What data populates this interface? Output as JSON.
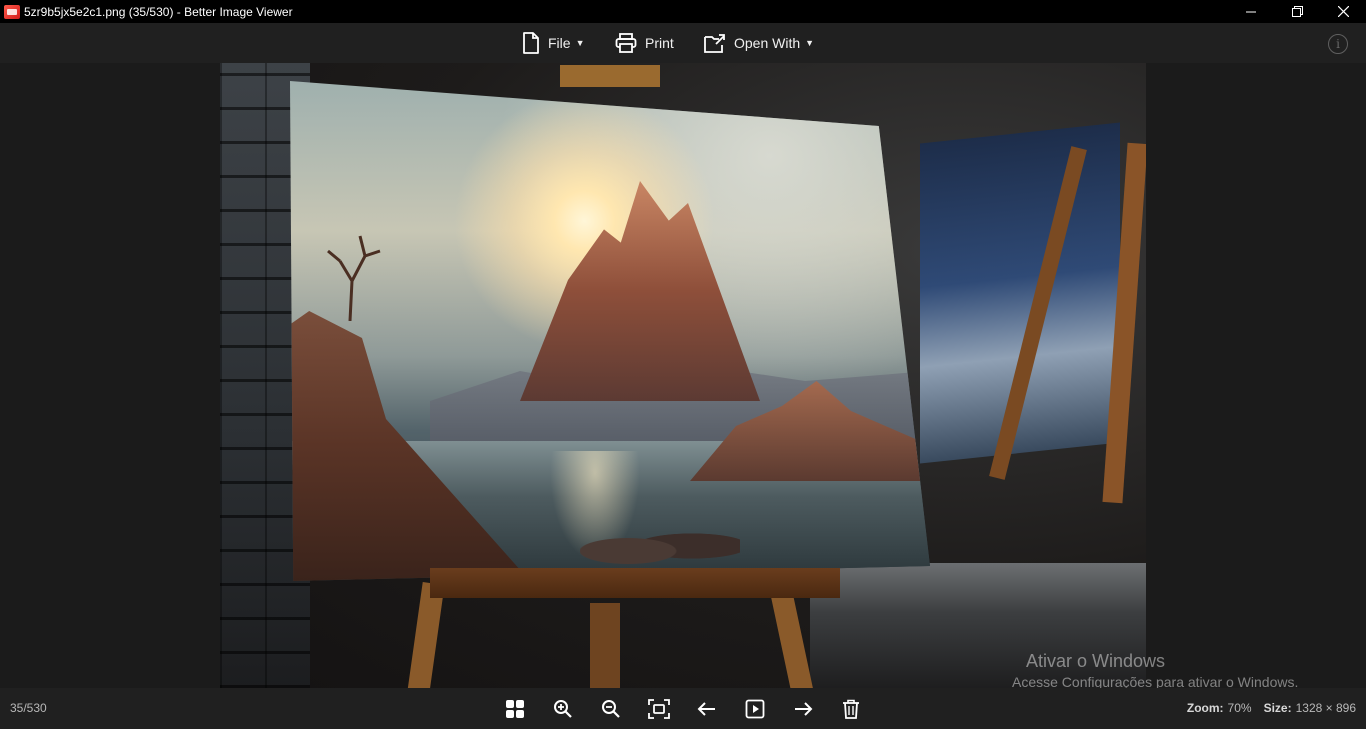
{
  "window": {
    "title": "5zr9b5jx5e2c1.png (35/530) - Better Image Viewer",
    "app_icon": "image-viewer-app-icon",
    "controls": [
      "minimize-icon",
      "restore-icon",
      "close-icon"
    ]
  },
  "toolbar": {
    "file_label": "File",
    "print_label": "Print",
    "open_with_label": "Open With",
    "info_glyph": "i"
  },
  "image": {
    "description_icon": "photo-of-landscape-painting-on-easel"
  },
  "watermark": {
    "title": "Ativar o Windows",
    "subtitle": "Acesse Configurações para ativar o Windows."
  },
  "bottom": {
    "counter": "35/530",
    "buttons": [
      "gallery-grid-icon",
      "zoom-in-icon",
      "zoom-out-icon",
      "fit-screen-icon",
      "previous-arrow-icon",
      "slideshow-play-icon",
      "next-arrow-icon",
      "delete-trash-icon"
    ],
    "zoom_label": "Zoom:",
    "zoom_value": "70%",
    "size_label": "Size:",
    "size_value": "1328 × 896"
  },
  "colors": {
    "titlebar": "#000000",
    "toolbar": "#202020",
    "canvas": "#1b1b1b",
    "app_icon": "#e0322a"
  }
}
